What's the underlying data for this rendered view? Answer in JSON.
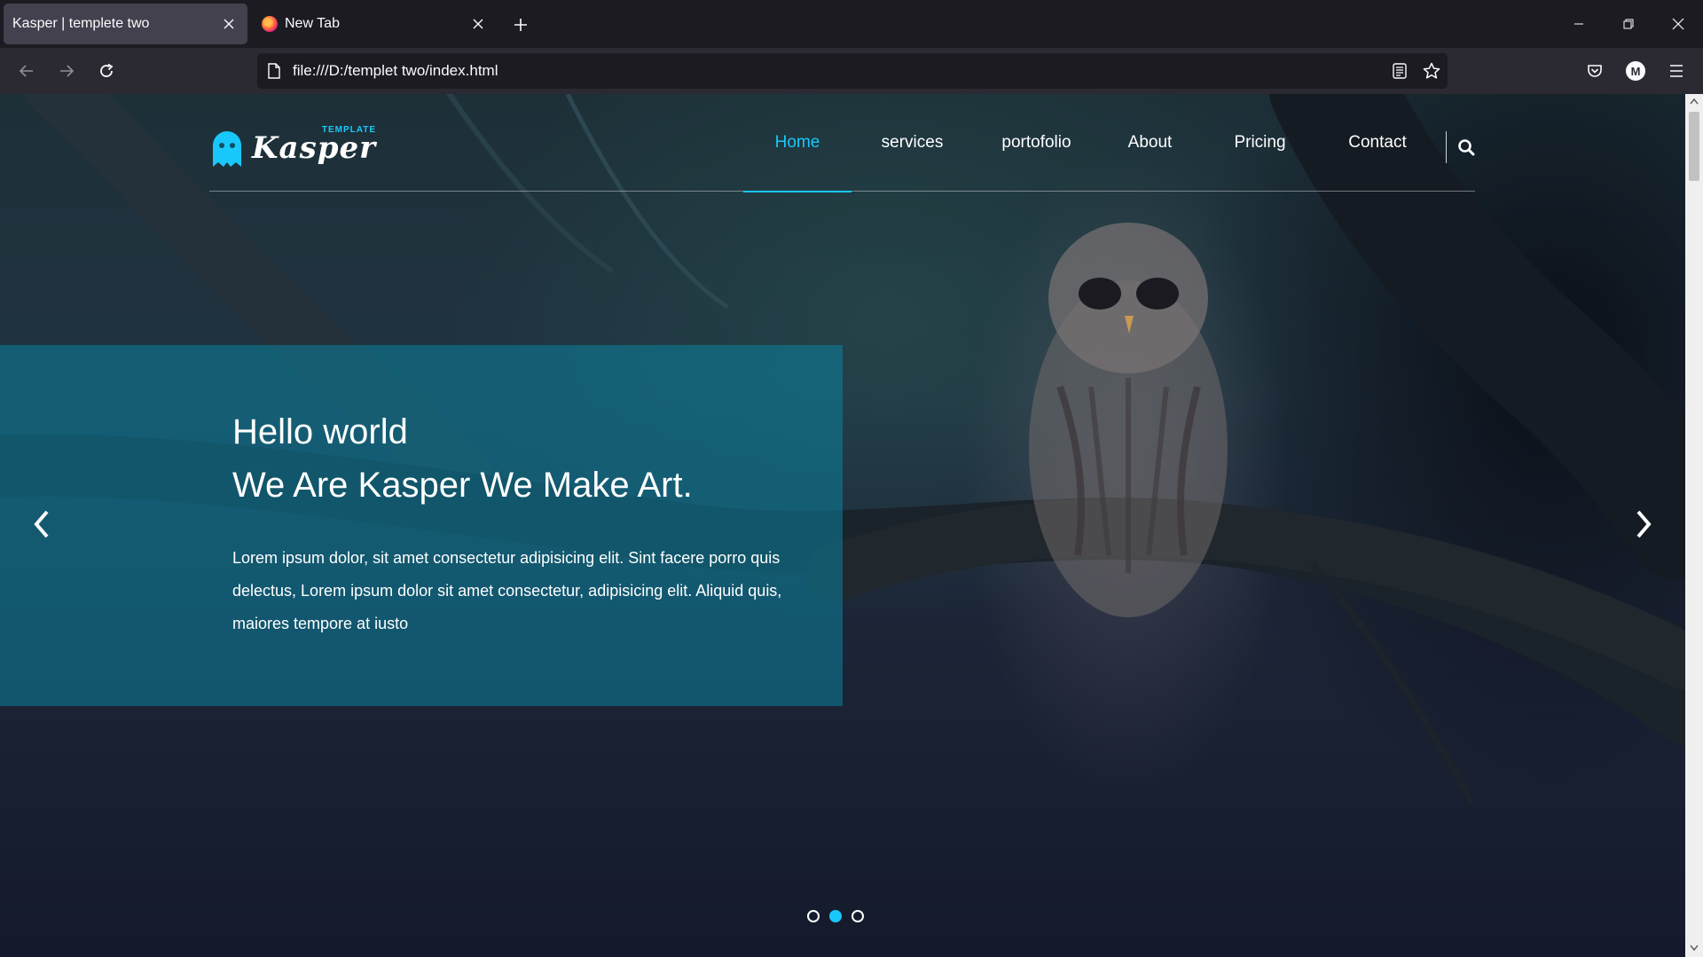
{
  "browser": {
    "tabs": [
      {
        "title": "Kasper | templete two",
        "active": true
      },
      {
        "title": "New Tab",
        "active": false
      }
    ],
    "url": "file:///D:/templet two/index.html",
    "account_initial": "M"
  },
  "site": {
    "logo": {
      "script": "Kasper",
      "small": "TEMPLATE"
    },
    "nav": [
      {
        "label": "Home",
        "active": true
      },
      {
        "label": "services",
        "active": false
      },
      {
        "label": "portofolio",
        "active": false
      },
      {
        "label": "About",
        "active": false
      },
      {
        "label": "Pricing",
        "active": false
      },
      {
        "label": "Contact",
        "active": false
      }
    ],
    "hero": {
      "line1": "Hello world",
      "line2": "We Are Kasper We Make Art.",
      "body": "Lorem ipsum dolor, sit amet consectetur adipisicing elit. Sint facere porro quis delectus, Lorem ipsum dolor sit amet consectetur, adipisicing elit. Aliquid quis, maiores tempore at iusto"
    },
    "slider": {
      "slide_count": 3,
      "active_index": 1
    }
  },
  "colors": {
    "accent": "#19c8fa",
    "hero_box": "#0b829e"
  },
  "icons": [
    "back-icon",
    "forward-icon",
    "reload-icon",
    "page-icon",
    "reader-view-icon",
    "bookmark-star-icon",
    "pocket-icon",
    "menu-icon",
    "search-icon",
    "chevron-left-icon",
    "chevron-right-icon",
    "ghost-logo-icon"
  ]
}
